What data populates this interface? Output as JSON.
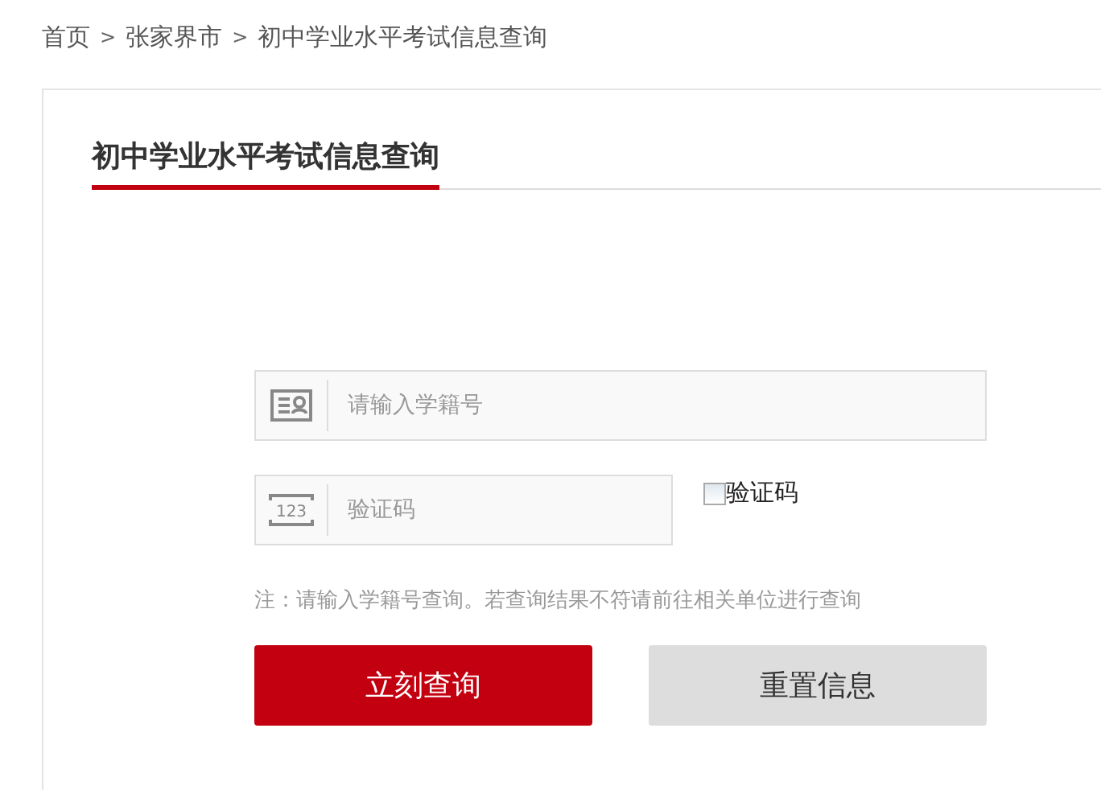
{
  "breadcrumb": [
    {
      "kind": "link",
      "text": "首页"
    },
    {
      "kind": "separator",
      "text": ">"
    },
    {
      "kind": "link",
      "text": "张家界市"
    },
    {
      "kind": "separator",
      "text": ">"
    },
    {
      "kind": "current",
      "text": "初中学业水平考试信息查询"
    }
  ],
  "panel": {
    "title": "初中学业水平考试信息查询",
    "fields": [
      {
        "kind": "id",
        "placeholder": "请输入学籍号"
      },
      {
        "kind": "captcha",
        "placeholder": "验证码",
        "icon_text": "123",
        "image_alt": "验证码"
      }
    ],
    "note": "注：请输入学籍号查询。若查询结果不符请前往相关单位进行查询",
    "buttons": [
      {
        "kind": "primary",
        "label": "立刻查询"
      },
      {
        "kind": "secondary",
        "label": "重置信息"
      }
    ]
  }
}
